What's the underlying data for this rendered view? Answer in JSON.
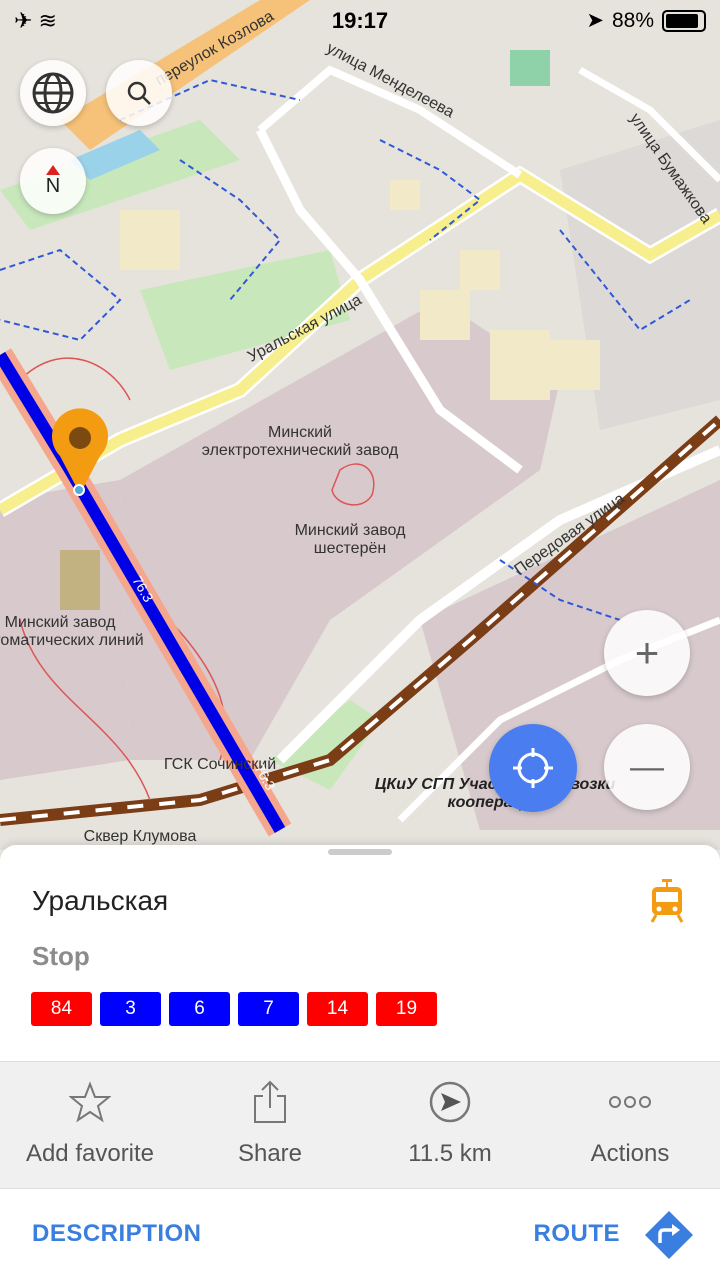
{
  "status_bar": {
    "time": "19:17",
    "battery": "88%"
  },
  "map": {
    "labels": {
      "plant_1": "Минский электротехнический завод",
      "plant_2": "Минский завод шестерён",
      "plant_3": "Минский завод автоматических линий",
      "gsk": "ГСК Сочинский",
      "ckiu": "ЦКиУ СГП Участок перевозки кооперации",
      "square": "Сквер Клумова",
      "street_uralskaya": "Уральская улица",
      "street_peredovaya": "Передовая улица",
      "street_mendeleeva": "улица Менделеева",
      "street_bumazhkova": "улица Бумажкова",
      "street_kozlova": "переулок Козлова",
      "route_ref": "76.3"
    },
    "compass_label": "N",
    "zoom_in_label": "+",
    "zoom_out_label": "—"
  },
  "place": {
    "title": "Уральская",
    "type": "Stop",
    "routes": [
      {
        "number": "84",
        "color": "#ff0000"
      },
      {
        "number": "3",
        "color": "#0000ff"
      },
      {
        "number": "6",
        "color": "#0000ff"
      },
      {
        "number": "7",
        "color": "#0000ff"
      },
      {
        "number": "14",
        "color": "#ff0000"
      },
      {
        "number": "19",
        "color": "#ff0000"
      }
    ],
    "icon": "tram-icon",
    "icon_color": "#f39c12"
  },
  "actions": {
    "favorite_label": "Add favorite",
    "share_label": "Share",
    "distance_label": "11.5 km",
    "more_label": "Actions"
  },
  "bottom": {
    "description_label": "DESCRIPTION",
    "route_label": "ROUTE"
  },
  "colors": {
    "accent": "#3a7ee0",
    "location_button": "#4a7df0",
    "marker": "#f39c12"
  }
}
